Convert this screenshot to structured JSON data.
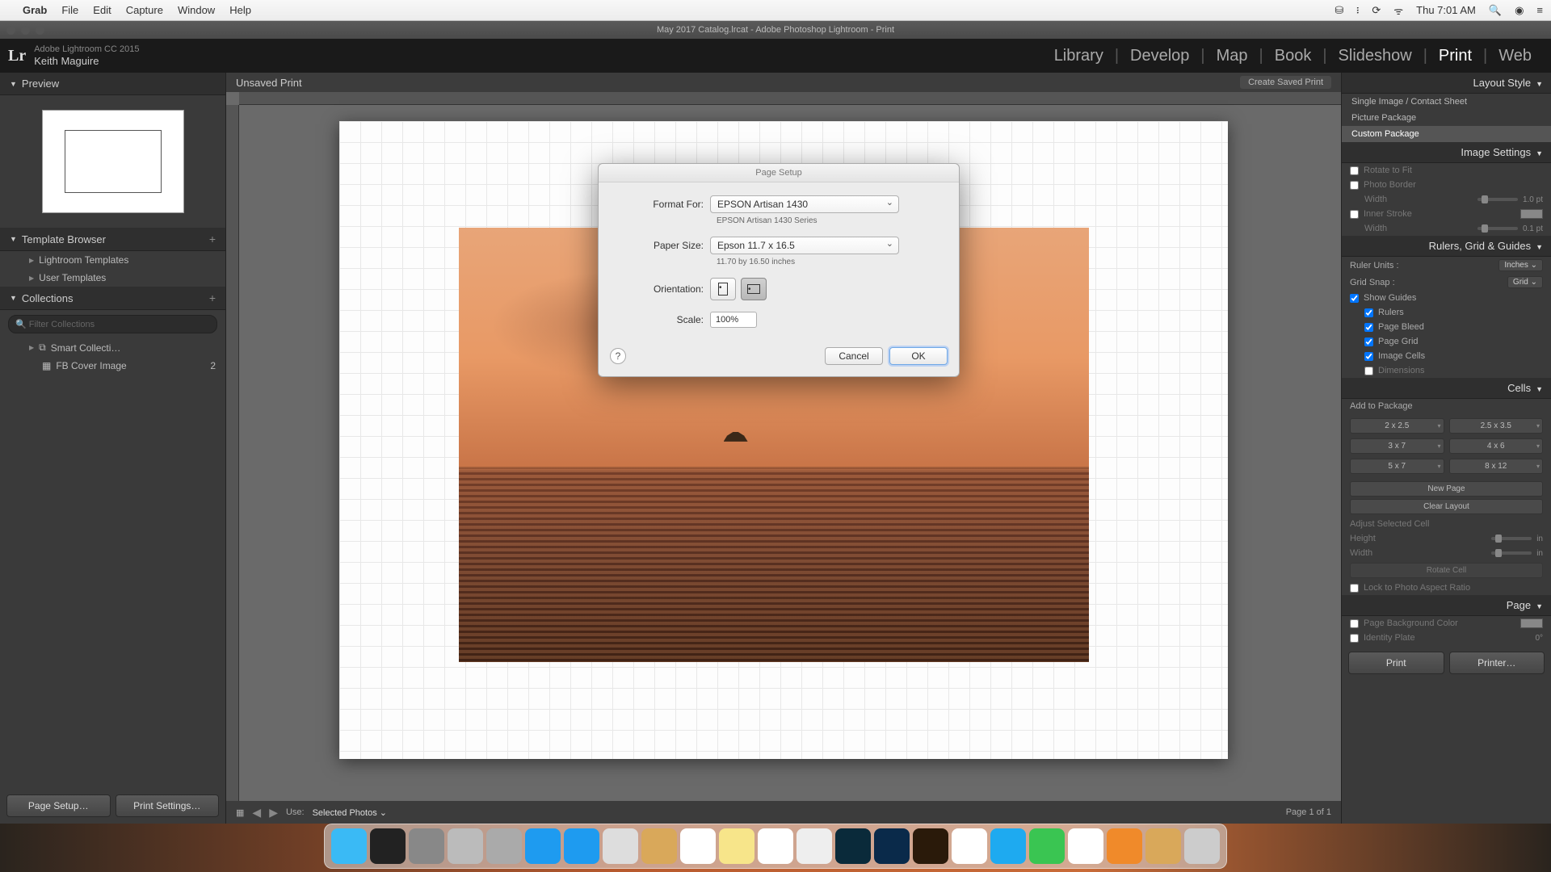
{
  "menubar": {
    "app": "Grab",
    "items": [
      "File",
      "Edit",
      "Capture",
      "Window",
      "Help"
    ],
    "clock": "Thu 7:01 AM"
  },
  "window": {
    "title": "May 2017 Catalog.lrcat - Adobe Photoshop Lightroom - Print"
  },
  "header": {
    "product": "Adobe Lightroom CC 2015",
    "user": "Keith Maguire",
    "modules": [
      "Library",
      "Develop",
      "Map",
      "Book",
      "Slideshow",
      "Print",
      "Web"
    ],
    "active_module": "Print"
  },
  "left": {
    "preview": "Preview",
    "template_browser": "Template Browser",
    "templates": [
      "Lightroom Templates",
      "User Templates"
    ],
    "collections": "Collections",
    "filter_placeholder": "Filter Collections",
    "coll_items": [
      {
        "name": "Smart Collecti…",
        "count": ""
      },
      {
        "name": "FB Cover Image",
        "count": "2"
      }
    ],
    "page_setup_btn": "Page Setup…",
    "print_settings_btn": "Print Settings…"
  },
  "center": {
    "doc_title": "Unsaved Print",
    "create_saved": "Create Saved Print",
    "use_label": "Use:",
    "use_value": "Selected Photos",
    "page_of": "Page 1 of 1"
  },
  "right": {
    "layout_style": "Layout Style",
    "styles": [
      "Single Image / Contact Sheet",
      "Picture Package",
      "Custom Package"
    ],
    "image_settings": "Image Settings",
    "rotate_fit": "Rotate to Fit",
    "photo_border": "Photo Border",
    "width_lbl": "Width",
    "border_val": "1.0 pt",
    "inner_stroke": "Inner Stroke",
    "stroke_val": "0.1 pt",
    "rulers_header": "Rulers, Grid & Guides",
    "ruler_units_lbl": "Ruler Units :",
    "ruler_units_val": "Inches",
    "grid_snap_lbl": "Grid Snap :",
    "grid_snap_val": "Grid",
    "show_guides": "Show Guides",
    "guides": [
      "Rulers",
      "Page Bleed",
      "Page Grid",
      "Image Cells",
      "Dimensions"
    ],
    "guides_checked": [
      true,
      true,
      true,
      true,
      false
    ],
    "cells_header": "Cells",
    "add_package": "Add to Package",
    "cell_sizes": [
      "2 x 2.5",
      "2.5 x 3.5",
      "3 x 7",
      "4 x 6",
      "5 x 7",
      "8 x 12"
    ],
    "new_page": "New Page",
    "clear_layout": "Clear Layout",
    "adjust_cell": "Adjust Selected Cell",
    "height_lbl": "Height",
    "width2_lbl": "Width",
    "unit": "in",
    "rotate_cell": "Rotate Cell",
    "lock_ratio": "Lock to Photo Aspect Ratio",
    "page_header": "Page",
    "page_bg": "Page Background Color",
    "identity": "Identity Plate",
    "identity_angle": "0°",
    "print_btn": "Print",
    "printer_btn": "Printer…"
  },
  "dialog": {
    "title": "Page Setup",
    "format_for_lbl": "Format For:",
    "format_for_val": "EPSON Artisan 1430",
    "format_for_sub": "EPSON Artisan 1430 Series",
    "paper_size_lbl": "Paper Size:",
    "paper_size_val": "Epson 11.7 x 16.5",
    "paper_size_sub": "11.70 by 16.50 inches",
    "orientation_lbl": "Orientation:",
    "scale_lbl": "Scale:",
    "scale_val": "100%",
    "help": "?",
    "cancel": "Cancel",
    "ok": "OK"
  },
  "dock": [
    {
      "name": "finder",
      "bg": "#3abaf5"
    },
    {
      "name": "siri",
      "bg": "#222"
    },
    {
      "name": "settings",
      "bg": "#888"
    },
    {
      "name": "grab",
      "bg": "#bbb"
    },
    {
      "name": "launchpad",
      "bg": "#aaa"
    },
    {
      "name": "appstore",
      "bg": "#1e9bf0"
    },
    {
      "name": "safari",
      "bg": "#1e9bf0"
    },
    {
      "name": "maps",
      "bg": "#ddd"
    },
    {
      "name": "notes2",
      "bg": "#d9a85a"
    },
    {
      "name": "calendar",
      "bg": "#fff"
    },
    {
      "name": "notes",
      "bg": "#f7e58a"
    },
    {
      "name": "reminders",
      "bg": "#fff"
    },
    {
      "name": "maps2",
      "bg": "#eee"
    },
    {
      "name": "lightroom",
      "bg": "#0a2a3a"
    },
    {
      "name": "photoshop",
      "bg": "#0a2a4a"
    },
    {
      "name": "bridge",
      "bg": "#2a1a0a"
    },
    {
      "name": "photos",
      "bg": "#fff"
    },
    {
      "name": "messages",
      "bg": "#1eaaf0"
    },
    {
      "name": "facetime",
      "bg": "#3ac552"
    },
    {
      "name": "itunes",
      "bg": "#fff"
    },
    {
      "name": "ibooks",
      "bg": "#f08a2a"
    },
    {
      "name": "box",
      "bg": "#d9a85a"
    },
    {
      "name": "trash",
      "bg": "#ccc"
    }
  ]
}
